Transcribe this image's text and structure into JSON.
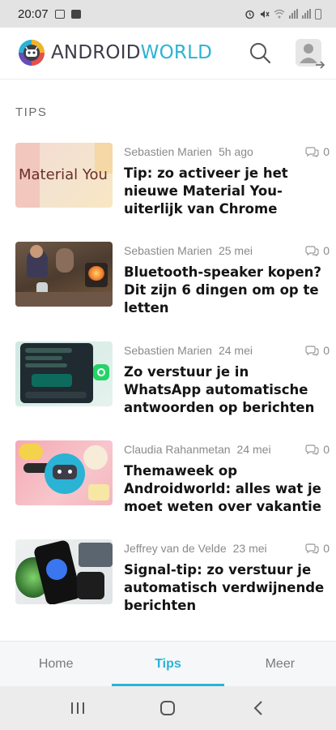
{
  "status_bar": {
    "time": "20:07",
    "left_icons": [
      "gallery-icon",
      "notification-icon"
    ],
    "right_icons": [
      "alarm-icon",
      "mute-icon",
      "wifi-icon",
      "signal-icon",
      "battery-icon"
    ]
  },
  "header": {
    "logo_part1": "ANDROID",
    "logo_part2": "WORLD",
    "search_icon": "search-icon",
    "account_icon": "account-login-icon",
    "accent_color": "#2bb3d5"
  },
  "section": {
    "label": "TIPS"
  },
  "articles": [
    {
      "author": "Sebastien Marien",
      "date": "5h ago",
      "comments": "0",
      "title": "Tip: zo activeer je het nieuwe Material You-uiterlijk van Chrome",
      "thumb_text": "Material You"
    },
    {
      "author": "Sebastien Marien",
      "date": "25 mei",
      "comments": "0",
      "title": "Bluetooth-speaker kopen? Dit zijn 6 dingen om op te letten"
    },
    {
      "author": "Sebastien Marien",
      "date": "24 mei",
      "comments": "0",
      "title": "Zo verstuur je in WhatsApp automatische antwoorden op berichten"
    },
    {
      "author": "Claudia Rahanmetan",
      "date": "24 mei",
      "comments": "0",
      "title": "Themaweek op Androidworld: alles wat je moet weten over vakantie"
    },
    {
      "author": "Jeffrey van de Velde",
      "date": "23 mei",
      "comments": "0",
      "title": "Signal-tip: zo verstuur je automatisch verdwijnende berichten"
    }
  ],
  "tabs": [
    {
      "label": "Home",
      "active": false
    },
    {
      "label": "Tips",
      "active": true
    },
    {
      "label": "Meer",
      "active": false
    }
  ],
  "system_nav": [
    "recents-icon",
    "home-icon",
    "back-icon"
  ]
}
